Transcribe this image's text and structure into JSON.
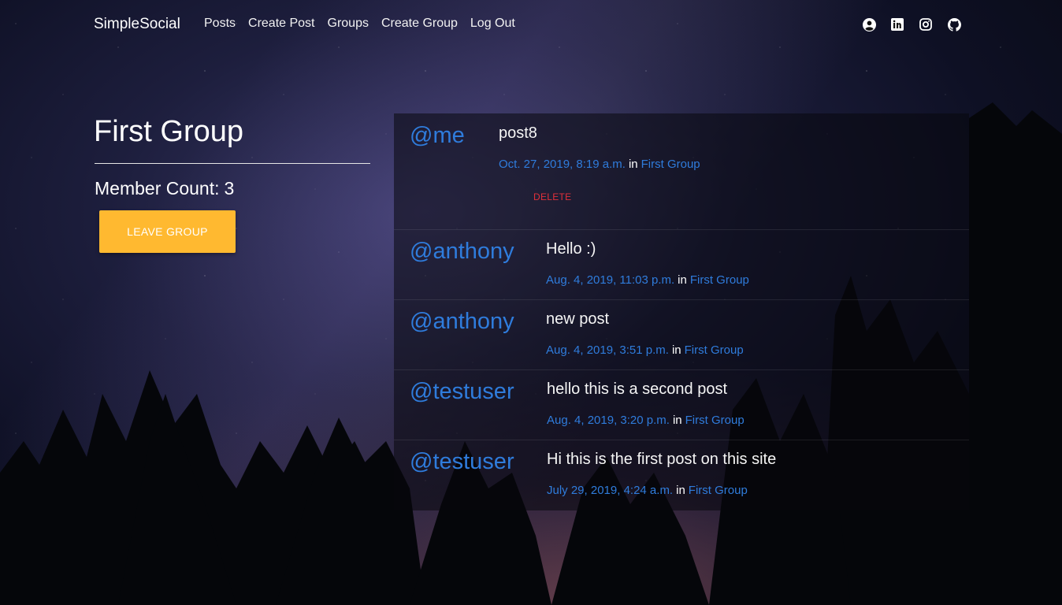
{
  "nav": {
    "brand": "SimpleSocial",
    "links": [
      "Posts",
      "Create Post",
      "Groups",
      "Create Group",
      "Log Out"
    ],
    "icons": [
      "user-circle-icon",
      "linkedin-icon",
      "instagram-icon",
      "github-icon"
    ]
  },
  "group": {
    "title": "First Group",
    "member_label": "Member Count:",
    "member_count": "3",
    "leave_button": "LEAVE GROUP"
  },
  "posts": [
    {
      "author": "@me",
      "text": "post8",
      "date": "Oct. 27, 2019, 8:19 a.m.",
      "in": "in",
      "group": "First Group",
      "delete": "DELETE"
    },
    {
      "author": "@anthony",
      "text": "Hello :)",
      "date": "Aug. 4, 2019, 11:03 p.m.",
      "in": "in",
      "group": "First Group"
    },
    {
      "author": "@anthony",
      "text": "new post",
      "date": "Aug. 4, 2019, 3:51 p.m.",
      "in": "in",
      "group": "First Group"
    },
    {
      "author": "@testuser",
      "text": "hello this is a second post",
      "date": "Aug. 4, 2019, 3:20 p.m.",
      "in": "in",
      "group": "First Group"
    },
    {
      "author": "@testuser",
      "text": "Hi this is the first post on this site",
      "date": "July 29, 2019, 4:24 a.m.",
      "in": "in",
      "group": "First Group"
    }
  ],
  "colors": {
    "accent_link": "#2f7cdc",
    "leave_button": "#ffb930",
    "delete": "#e0303a"
  }
}
